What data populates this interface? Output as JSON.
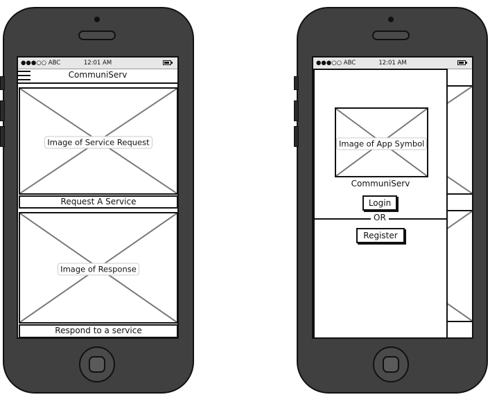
{
  "status_bar": {
    "carrier": "●●●○○ ABC",
    "time": "12:01 AM"
  },
  "screen_home": {
    "title": "CommuniServ",
    "request_card": {
      "image_label": "Image of Service Request",
      "caption": "Request A Service"
    },
    "response_card": {
      "image_label": "Image of Response",
      "caption": "Respond to a service"
    }
  },
  "screen_login": {
    "image_label": "Image of App Symbol",
    "app_name": "CommuniServ",
    "login_button": "Login",
    "separator": "OR",
    "register_button": "Register"
  },
  "colors": {
    "phone_body": "#404040",
    "outline": "#111111",
    "status_bar": "#e7e7e7"
  }
}
